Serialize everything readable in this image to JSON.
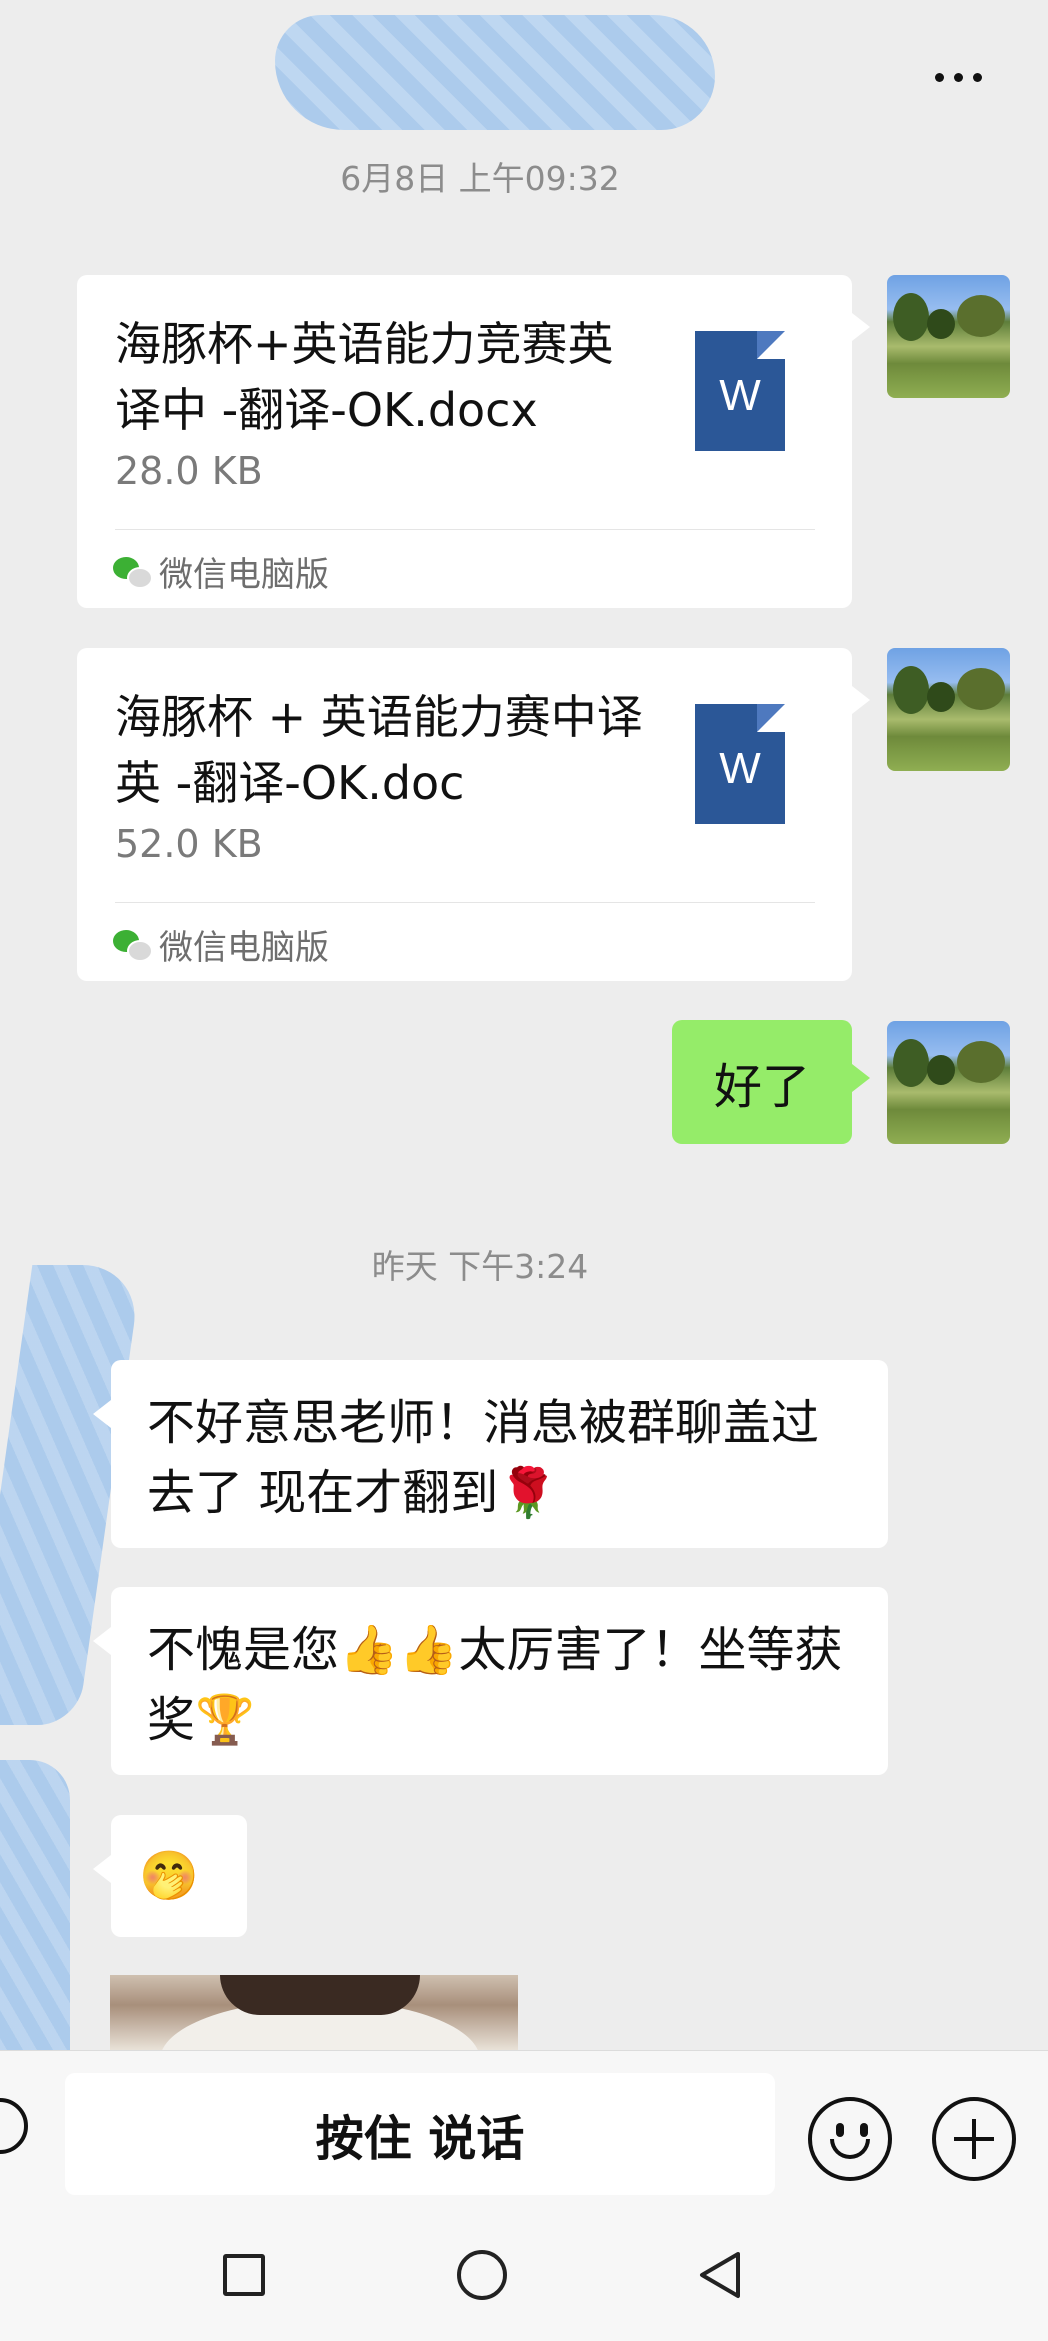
{
  "header": {
    "title": "",
    "more_label": "..."
  },
  "timestamps": {
    "first": "6月8日 上午09:32",
    "second": "昨天 下午3:24"
  },
  "messages": {
    "file1": {
      "name": "海豚杯+英语能力竞赛英译中 -翻译-OK.docx",
      "size": "28.0 KB",
      "source": "微信电脑版",
      "icon_letter": "W"
    },
    "file2": {
      "name": "海豚杯 + 英语能力赛中译英 -翻译-OK.doc",
      "size": "52.0 KB",
      "source": "微信电脑版",
      "icon_letter": "W"
    },
    "sent_text": "好了",
    "reply1": "不好意思老师！消息被群聊盖过去了 现在才翻到🌹",
    "reply2": "不愧是您👍👍太厉害了！坐等获奖🏆",
    "reply3": "🤭"
  },
  "input_bar": {
    "talk_label": "按住 说话"
  },
  "colors": {
    "background": "#ededed",
    "sent_bubble": "#95ec69",
    "word_icon": "#2b5797",
    "wechat_green": "#3cb034"
  },
  "icons": {
    "more": "more-icon",
    "keyboard": "keyboard-icon",
    "emoji": "emoji-icon",
    "plus": "plus-icon",
    "file": "word-file-icon"
  }
}
